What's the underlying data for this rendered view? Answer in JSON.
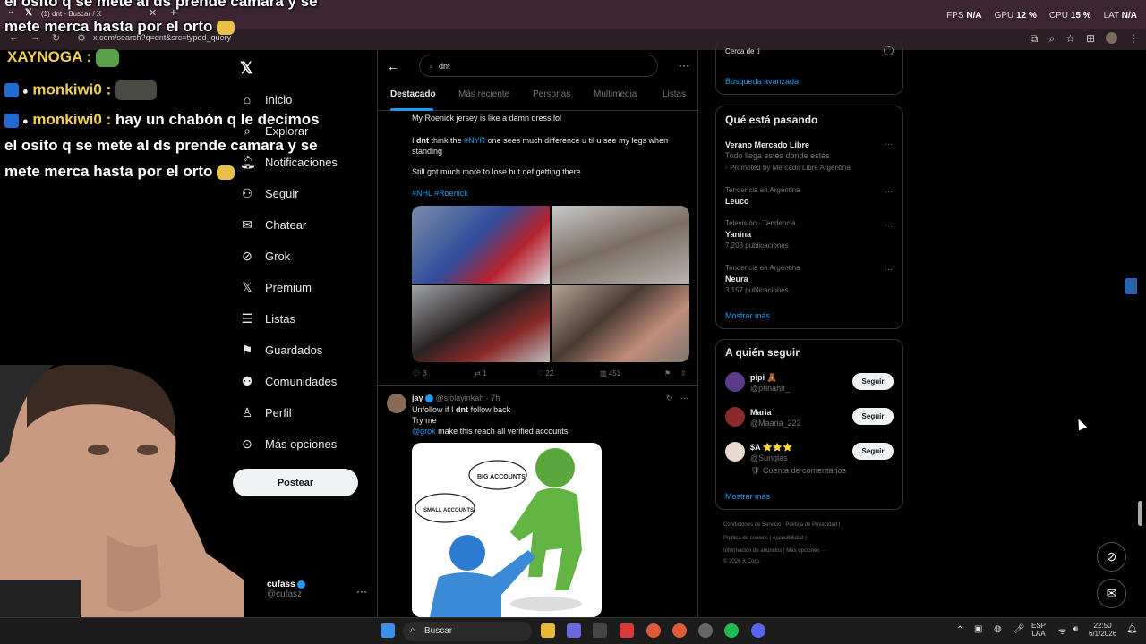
{
  "browser": {
    "tab_title": "(1) dnt - Buscar / X",
    "url": "x.com/search?q=dnt&src=typed_query",
    "stats": [
      {
        "label": "FPS",
        "value": "N/A"
      },
      {
        "label": "GPU",
        "value": "12 %"
      },
      {
        "label": "CPU",
        "value": "15 %"
      },
      {
        "label": "LAT",
        "value": "N/A"
      }
    ]
  },
  "overlay_chat": {
    "line_top1": "el osito q se mete al ds prende camara y se",
    "line_top2": "mete merca hasta por el orto",
    "user1": "XAYNOGA :",
    "user2": "monkiwi0 :",
    "user3": "monkiwi0 :",
    "msg3a": "hay un chabón q le decimos",
    "msg3b": "el osito q se mete al ds prende camara y se",
    "msg3c": "mete merca hasta por el orto"
  },
  "sidenav": {
    "items": [
      {
        "label": "Inicio",
        "icon": "home-icon"
      },
      {
        "label": "Explorar",
        "icon": "search-icon"
      },
      {
        "label": "Notificaciones",
        "icon": "bell-icon"
      },
      {
        "label": "Seguir",
        "icon": "follow-icon"
      },
      {
        "label": "Chatear",
        "icon": "mail-icon"
      },
      {
        "label": "Grok",
        "icon": "grok-icon"
      },
      {
        "label": "Premium",
        "icon": "x-icon"
      },
      {
        "label": "Listas",
        "icon": "list-icon"
      },
      {
        "label": "Guardados",
        "icon": "bookmark-icon"
      },
      {
        "label": "Comunidades",
        "icon": "communities-icon"
      },
      {
        "label": "Perfil",
        "icon": "profile-icon"
      },
      {
        "label": "Más opciones",
        "icon": "more-icon"
      }
    ],
    "post_button": "Postear",
    "account_name": "cufass",
    "account_handle": "@cufasz"
  },
  "main": {
    "search_value": "dnt",
    "tabs": [
      "Destacado",
      "Más reciente",
      "Personas",
      "Multimedia",
      "Listas"
    ],
    "post1": {
      "line1": "My Roenick jersey is like a damn dress lol",
      "line2_pre": "I",
      "line2_bold": "dnt",
      "line2_mid": "think the",
      "line2_tag": "#NYR",
      "line2_post": "one sees much difference u til u see my legs when",
      "line3": "standing",
      "line4": "Still got much more to lose but def getting there",
      "tags": "#NHL #Roenick",
      "replies": "3",
      "reposts": "1",
      "likes": "22",
      "views": "451"
    },
    "post2": {
      "name": "jay",
      "handle": "@sjolayinkah",
      "time": "· 7h",
      "line1_pre": "Unfollow if I",
      "line1_bold": "dnt",
      "line1_post": "follow back",
      "line2": "Try me",
      "line3_mention": "@grok",
      "line3_post": "make this reach all verified accounts",
      "bubble1": "BIG ACCOUNTS",
      "bubble2": "SMALL ACCOUNTS"
    }
  },
  "right": {
    "search_partial": "Cerca de ti",
    "advanced": "Búsqueda avanzada",
    "trends_title": "Qué está pasando",
    "trends": [
      {
        "context": "",
        "title": "Verano Mercado Libre",
        "sub": "Todo llega estés donde estés",
        "meta": "Promoted by Mercado Libre Argentina"
      },
      {
        "context": "Tendencia en Argentina",
        "title": "Leuco",
        "sub": "",
        "meta": ""
      },
      {
        "context": "Televisión · Tendencia",
        "title": "Yanina",
        "sub": "",
        "meta": "7.208 publicaciones"
      },
      {
        "context": "Tendencia en Argentina",
        "title": "Neura",
        "sub": "",
        "meta": "3.157 publicaciones"
      }
    ],
    "show_more": "Mostrar más",
    "follow_title": "A quién seguir",
    "follow": [
      {
        "name": "pipi 🧸",
        "handle": "@prinahlr_",
        "button": "Seguir",
        "color": "#5b3a8a"
      },
      {
        "name": "Maria",
        "handle": "@Maaria_222",
        "button": "Seguir",
        "color": "#8a2a2a"
      },
      {
        "name": "$A ⭐⭐⭐",
        "handle": "@Sunglas_",
        "note": "Cuenta de comentarios",
        "button": "Seguir",
        "color": "#e8d8d0"
      }
    ],
    "follow_more": "Mostrar más",
    "footer": [
      "Condiciones de Servicio",
      "Política de Privacidad",
      "Política de cookies",
      "Accesibilidad",
      "Información de anuncios",
      "Más opciones ···",
      "© 2026 X Corp."
    ]
  },
  "taskbar": {
    "search": "Buscar",
    "lang1": "ESP",
    "lang2": "LAA",
    "time": "22:50",
    "date": "6/1/2026"
  }
}
